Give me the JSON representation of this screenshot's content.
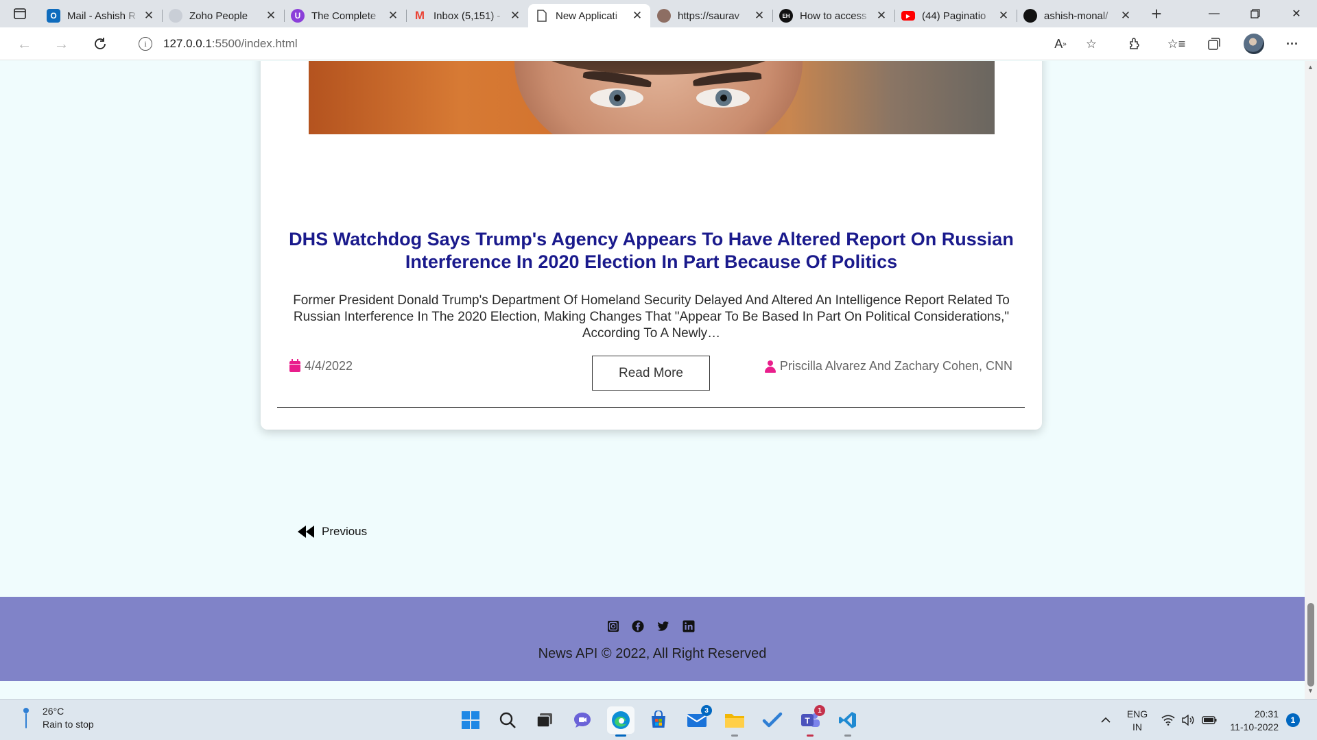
{
  "browser": {
    "tabs": [
      {
        "title": "Mail - Ashish R",
        "icon": "outlook-icon",
        "color": "#0f6cbd"
      },
      {
        "title": "Zoho People",
        "icon": "zoho-icon",
        "color": "#9aa0a6"
      },
      {
        "title": "The Complete",
        "icon": "course-icon",
        "color": "#8b3fd9"
      },
      {
        "title": "Inbox (5,151) -",
        "icon": "gmail-icon",
        "color": "#ea4335"
      },
      {
        "title": "New Applicati",
        "icon": "page-icon",
        "color": "#555555",
        "active": true
      },
      {
        "title": "https://saurav",
        "icon": "avatar-icon",
        "color": "#8d6e63"
      },
      {
        "title": "How to access",
        "icon": "eh-icon",
        "color": "#111111"
      },
      {
        "title": "(44) Paginatio",
        "icon": "youtube-icon",
        "color": "#ff0000"
      },
      {
        "title": "ashish-monal/",
        "icon": "github-icon",
        "color": "#111111"
      }
    ],
    "url_host": "127.0.0.1",
    "url_path": ":5500/index.html"
  },
  "article": {
    "title": "DHS Watchdog Says Trump's Agency Appears To Have Altered Report On Russian Interference In 2020 Election In Part Because Of Politics",
    "description": "Former President Donald Trump's Department Of Homeland Security Delayed And Altered An Intelligence Report Related To Russian Interference In The 2020 Election, Making Changes That \"Appear To Be Based In Part On Political Considerations,\" According To A Newly…",
    "read_more_label": "Read More",
    "date": "4/4/2022",
    "author": "Priscilla Alvarez And Zachary Cohen, CNN"
  },
  "pagination": {
    "previous_label": "Previous"
  },
  "footer": {
    "copyright": "News API © 2022, All Right Reserved",
    "social_icons": [
      "instagram-icon",
      "facebook-icon",
      "twitter-icon",
      "linkedin-icon"
    ],
    "background": "#8083c8"
  },
  "taskbar": {
    "weather_temp": "26°C",
    "weather_desc": "Rain to stop",
    "lang_line1": "ENG",
    "lang_line2": "IN",
    "time": "20:31",
    "date": "11-10-2022",
    "notifications": "1",
    "mail_badge": "3",
    "teams_badge": "1"
  },
  "colors": {
    "title_color": "#1a1a8c",
    "accent_pink": "#e91e8c",
    "page_bg": "#f0fcfd"
  }
}
